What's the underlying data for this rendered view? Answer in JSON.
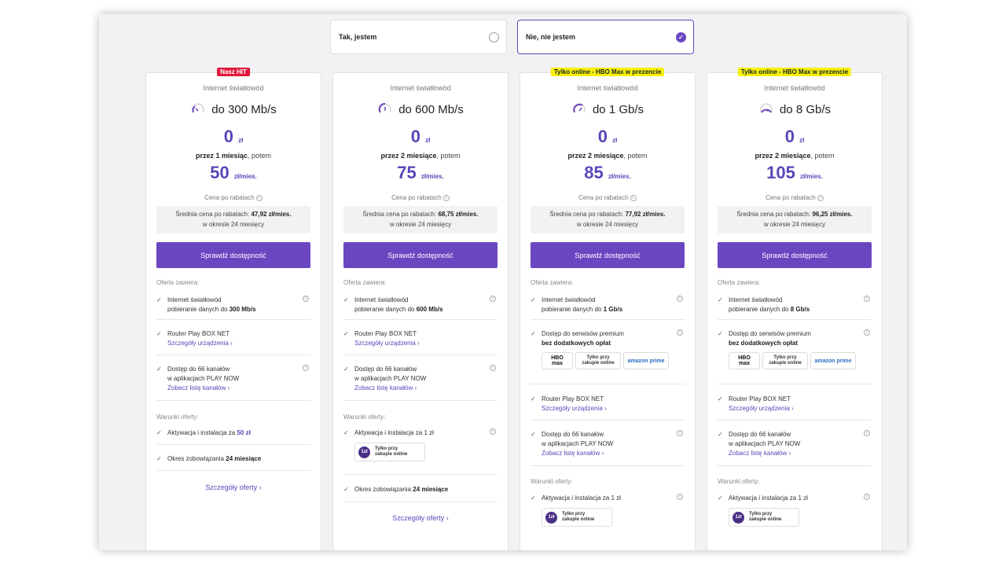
{
  "question": {
    "yes_label": "Tak, jestem",
    "no_label": "Nie, nie jestem",
    "selected": "no"
  },
  "common": {
    "kind": "Internet światłowód",
    "zero": "0",
    "currency": "zł",
    "per_month": "zł/mies.",
    "after_discounts": "Cena po rabatach",
    "avg_prefix": "Średnia cena po rabatach: ",
    "avg_suffix": "w okresie 24 miesięcy",
    "cta": "Sprawdź dostępność",
    "oferta_zawiera": "Oferta zawiera:",
    "warunki": "Warunki oferty:",
    "details": "Szczegóły oferty",
    "then": ", potem",
    "internet_l1": "Internet światłowód",
    "internet_l2_prefix": "pobieranie danych do ",
    "router": "Router Play BOX NET",
    "device_link": "Szczegóły urządzenia",
    "channels_l1": "Dostęp do 66 kanałów",
    "channels_l2": "w aplikacjach PLAY NOW",
    "channels_link": "Zobacz listę kanałów",
    "premium_l1": "Dostęp do serwisów premium",
    "premium_l2": "bez dodatkowych opłat",
    "activation_prefix": "Aktywacja i instalacja za ",
    "commitment_prefix": "Okres zobowiązania ",
    "commitment_value": "24 miesiące",
    "online_l1": "Tylko przy",
    "online_l2": "zakupie online",
    "coin": "1zł",
    "hbo_l1": "HBO",
    "hbo_l2": "max",
    "hbo_l3": "Podstawowy",
    "amazon": "amazon prime"
  },
  "plans": [
    {
      "badge": "Nasz HIT",
      "speed": "do 300 Mb/s",
      "period": "przez 1 miesiąc",
      "price": "50",
      "avg": "47,92 zł/mies.",
      "download": "300 Mb/s",
      "activation": "50 zł"
    },
    {
      "badge": "",
      "speed": "do 600 Mb/s",
      "period": "przez 2 miesiące",
      "price": "75",
      "avg": "68,75 zł/mies.",
      "download": "600 Mb/s",
      "activation": "1 zł"
    },
    {
      "badge": "Tylko online - HBO Max w prezencie",
      "speed": "do 1 Gb/s",
      "period": "przez 2 miesiące",
      "price": "85",
      "avg": "77,92 zł/mies.",
      "download": "1 Gb/s",
      "activation": "1 zł"
    },
    {
      "badge": "Tylko online - HBO Max w prezencie",
      "speed": "do 8 Gb/s",
      "period": "przez 2 miesiące",
      "price": "105",
      "avg": "96,25 zł/mies.",
      "download": "8 Gb/s",
      "activation": "1 zł"
    }
  ],
  "colors": {
    "accent": "#6b46c1",
    "price": "#5b45b8",
    "hit": "#e0193c",
    "promo": "#f5f20a"
  },
  "icons": {
    "speed": "speedometer-icon",
    "tick": "check-icon",
    "info": "info-icon",
    "chevron": "chevron-right-icon"
  }
}
